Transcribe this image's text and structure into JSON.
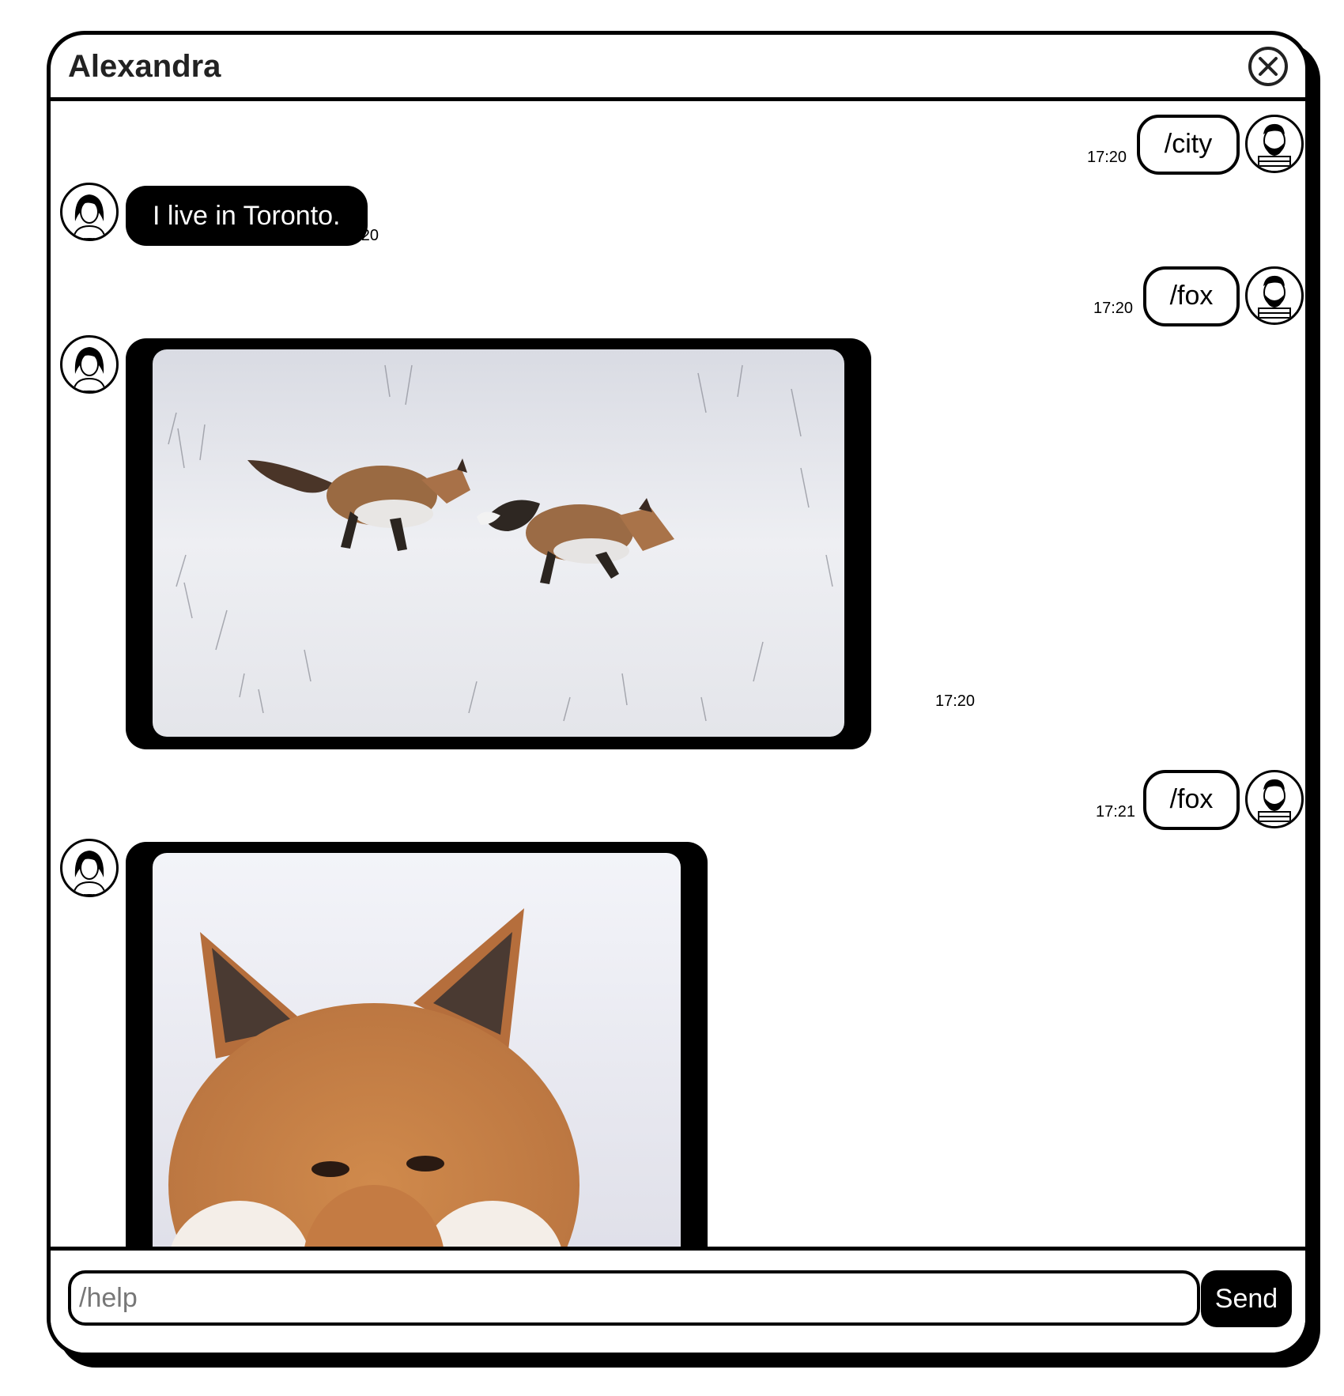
{
  "header": {
    "contact_name": "Alexandra"
  },
  "messages": [
    {
      "direction": "outgoing",
      "text": "/city",
      "time": "17:20"
    },
    {
      "direction": "incoming",
      "text": "I live in Toronto.",
      "time": "17:20"
    },
    {
      "direction": "outgoing",
      "text": "/fox",
      "time": "17:20"
    },
    {
      "direction": "incoming",
      "type": "image",
      "image": "two-foxes-running-in-snow",
      "time": "17:20"
    },
    {
      "direction": "outgoing",
      "text": "/fox",
      "time": "17:21"
    },
    {
      "direction": "incoming",
      "type": "image",
      "image": "red-fox-face-closeup",
      "time": ""
    }
  ],
  "composer": {
    "placeholder": "/help",
    "value": "",
    "send_label": "Send"
  },
  "icons": {
    "close": "close-icon",
    "user_avatar": "bearded-man-avatar",
    "contact_avatar": "woman-avatar"
  }
}
